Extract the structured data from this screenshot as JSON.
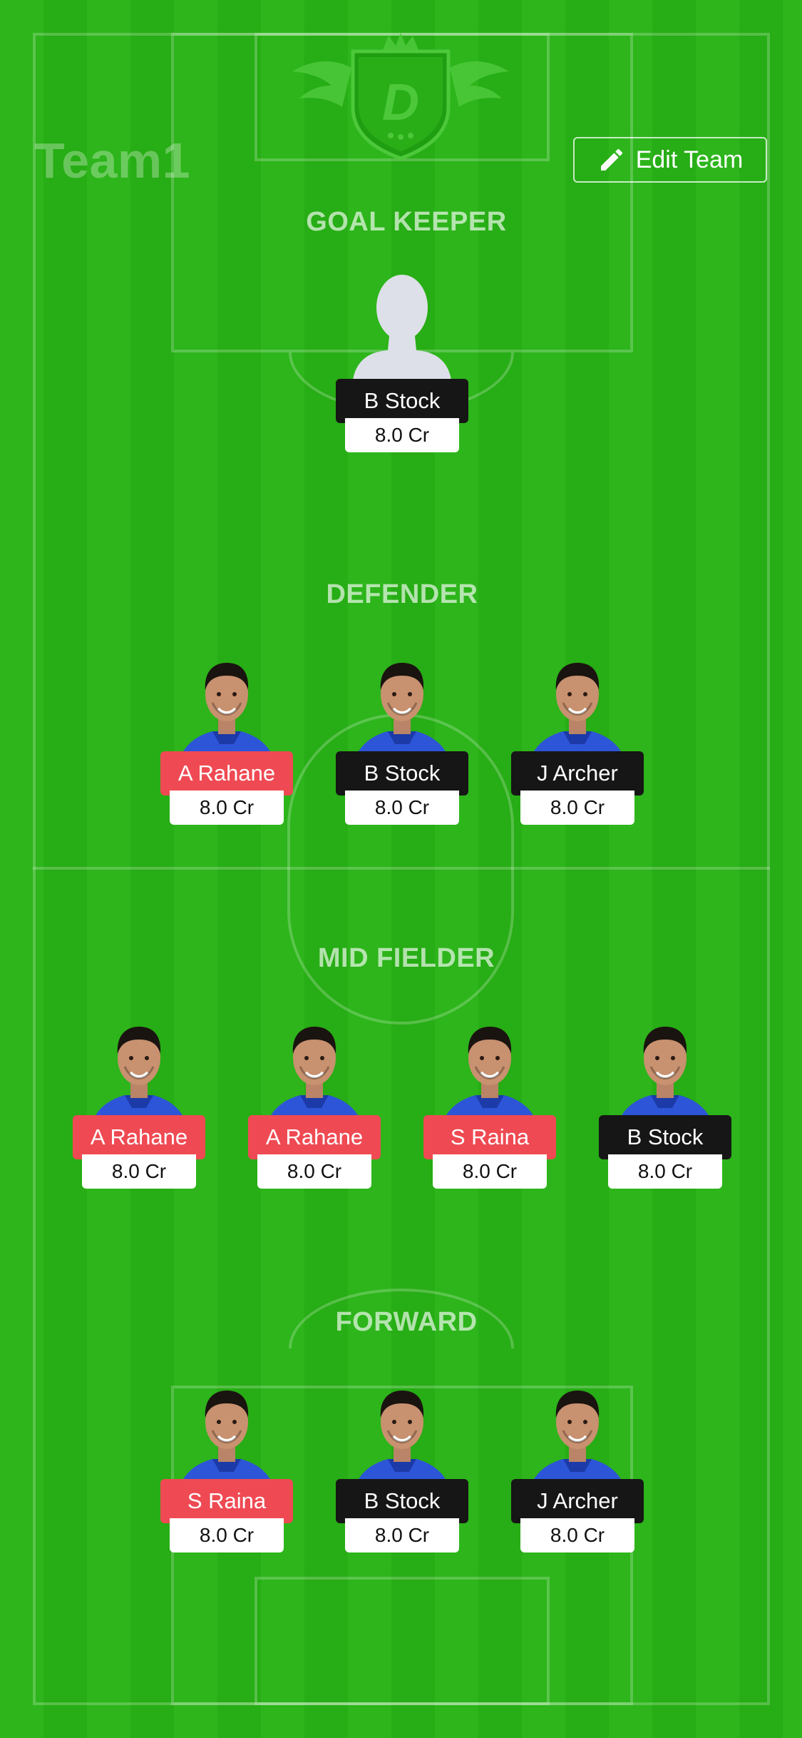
{
  "team": {
    "name": "Team1"
  },
  "edit_button": {
    "label": "Edit Team",
    "icon": "pencil-icon"
  },
  "logo": {
    "letter": "D",
    "icon": "dream11-shield-logo"
  },
  "colors": {
    "pitch": "#2db51b",
    "captain_badge": "#ef4a53",
    "player_badge": "#161616"
  },
  "sections": {
    "goalkeeper": {
      "title": "GOAL KEEPER",
      "players": [
        {
          "name": "B Stock",
          "price": "8.0 Cr",
          "badge": "black",
          "photo": "placeholder"
        }
      ]
    },
    "defender": {
      "title": "DEFENDER",
      "players": [
        {
          "name": "A Rahane",
          "price": "8.0 Cr",
          "badge": "red",
          "photo": "player"
        },
        {
          "name": "B Stock",
          "price": "8.0 Cr",
          "badge": "black",
          "photo": "player"
        },
        {
          "name": "J Archer",
          "price": "8.0 Cr",
          "badge": "black",
          "photo": "player"
        }
      ]
    },
    "midfielder": {
      "title": "MID FIELDER",
      "players": [
        {
          "name": "A Rahane",
          "price": "8.0 Cr",
          "badge": "red",
          "photo": "player"
        },
        {
          "name": "A Rahane",
          "price": "8.0 Cr",
          "badge": "red",
          "photo": "player"
        },
        {
          "name": "S Raina",
          "price": "8.0 Cr",
          "badge": "red",
          "photo": "player"
        },
        {
          "name": "B Stock",
          "price": "8.0 Cr",
          "badge": "black",
          "photo": "player"
        }
      ]
    },
    "forward": {
      "title": "FORWARD",
      "players": [
        {
          "name": "S Raina",
          "price": "8.0 Cr",
          "badge": "red",
          "photo": "player"
        },
        {
          "name": "B Stock",
          "price": "8.0 Cr",
          "badge": "black",
          "photo": "player"
        },
        {
          "name": "J Archer",
          "price": "8.0 Cr",
          "badge": "black",
          "photo": "player"
        }
      ]
    }
  }
}
